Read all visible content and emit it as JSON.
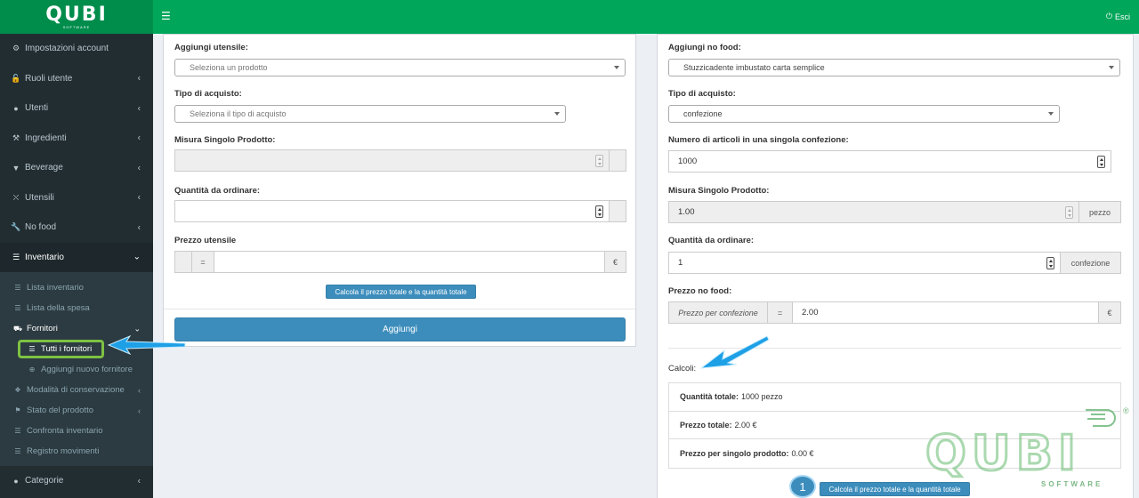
{
  "brand": {
    "name": "QUBI",
    "sub": "SOFTWARE",
    "reg": "®"
  },
  "topbar": {
    "logout_label": "Esci",
    "menu_icon": "hamburger-icon",
    "logout_icon": "power-icon"
  },
  "sidebar": {
    "items": [
      {
        "label": "Impostazioni account",
        "icon": "gear-icon"
      },
      {
        "label": "Ruoli utente",
        "icon": "unlock-icon"
      },
      {
        "label": "Utenti",
        "icon": "user-icon"
      },
      {
        "label": "Ingredienti",
        "icon": "ingredients-icon"
      },
      {
        "label": "Beverage",
        "icon": "cocktail-icon"
      },
      {
        "label": "Utensili",
        "icon": "cutlery-icon"
      },
      {
        "label": "No food",
        "icon": "wrench-icon"
      },
      {
        "label": "Inventario",
        "icon": "list-icon"
      }
    ],
    "inventario_sub": [
      {
        "label": "Lista inventario"
      },
      {
        "label": "Lista della spesa"
      },
      {
        "label": "Fornitori"
      },
      {
        "label": "Tutti i fornitori"
      },
      {
        "label": "Aggiungi nuovo fornitore"
      },
      {
        "label": "Modalità di conservazione"
      },
      {
        "label": "Stato del prodotto"
      },
      {
        "label": "Confronta inventario"
      },
      {
        "label": "Registro movimenti"
      }
    ],
    "categorie": {
      "label": "Categorie"
    }
  },
  "left_form": {
    "utensile_label": "Aggiungi utensile:",
    "utensile_placeholder": "Seleziona un prodotto",
    "tipo_label": "Tipo di acquisto:",
    "tipo_placeholder": "Seleziona il tipo di acquisto",
    "misura_label": "Misura Singolo Prodotto:",
    "misura_value": "",
    "quantita_label": "Quantità da ordinare:",
    "quantita_value": "",
    "prezzo_label": "Prezzo utensile",
    "prezzo_eq": "=",
    "prezzo_currency": "€",
    "prezzo_value": "",
    "calc_button": "Calcola il prezzo totale e la quantità totale",
    "add_button": "Aggiungi"
  },
  "right_form": {
    "nofood_label": "Aggiungi no food:",
    "nofood_value": "Stuzzicadente imbustato carta semplice",
    "tipo_label": "Tipo di acquisto:",
    "tipo_value": "confezione",
    "numero_label": "Numero di articoli in una singola confezione:",
    "numero_value": "1000",
    "misura_label": "Misura Singolo Prodotto:",
    "misura_value": "1.00",
    "misura_unit": "pezzo",
    "quantita_label": "Quantità da ordinare:",
    "quantita_value": "1",
    "quantita_unit": "confezione",
    "prezzo_label": "Prezzo no food:",
    "prezzo_addon": "Prezzo per confezione",
    "prezzo_eq": "=",
    "prezzo_value": "2.00",
    "prezzo_currency": "€",
    "calcoli_label": "Calcoli:",
    "calc_rows": [
      {
        "key": "Quantità totale:",
        "value": "1000 pezzo"
      },
      {
        "key": "Prezzo totale:",
        "value": "2.00 €"
      },
      {
        "key": "Prezzo per singolo prodotto:",
        "value": "0.00 €"
      }
    ],
    "calc_button": "Calcola il prezzo totale e la quantità totale",
    "step_badge": "1"
  },
  "colors": {
    "topbar": "#00a65a",
    "sidebar": "#222d32",
    "primary": "#3c8dbc",
    "highlight": "#7dc243",
    "arrow": "#1ea0e6"
  }
}
